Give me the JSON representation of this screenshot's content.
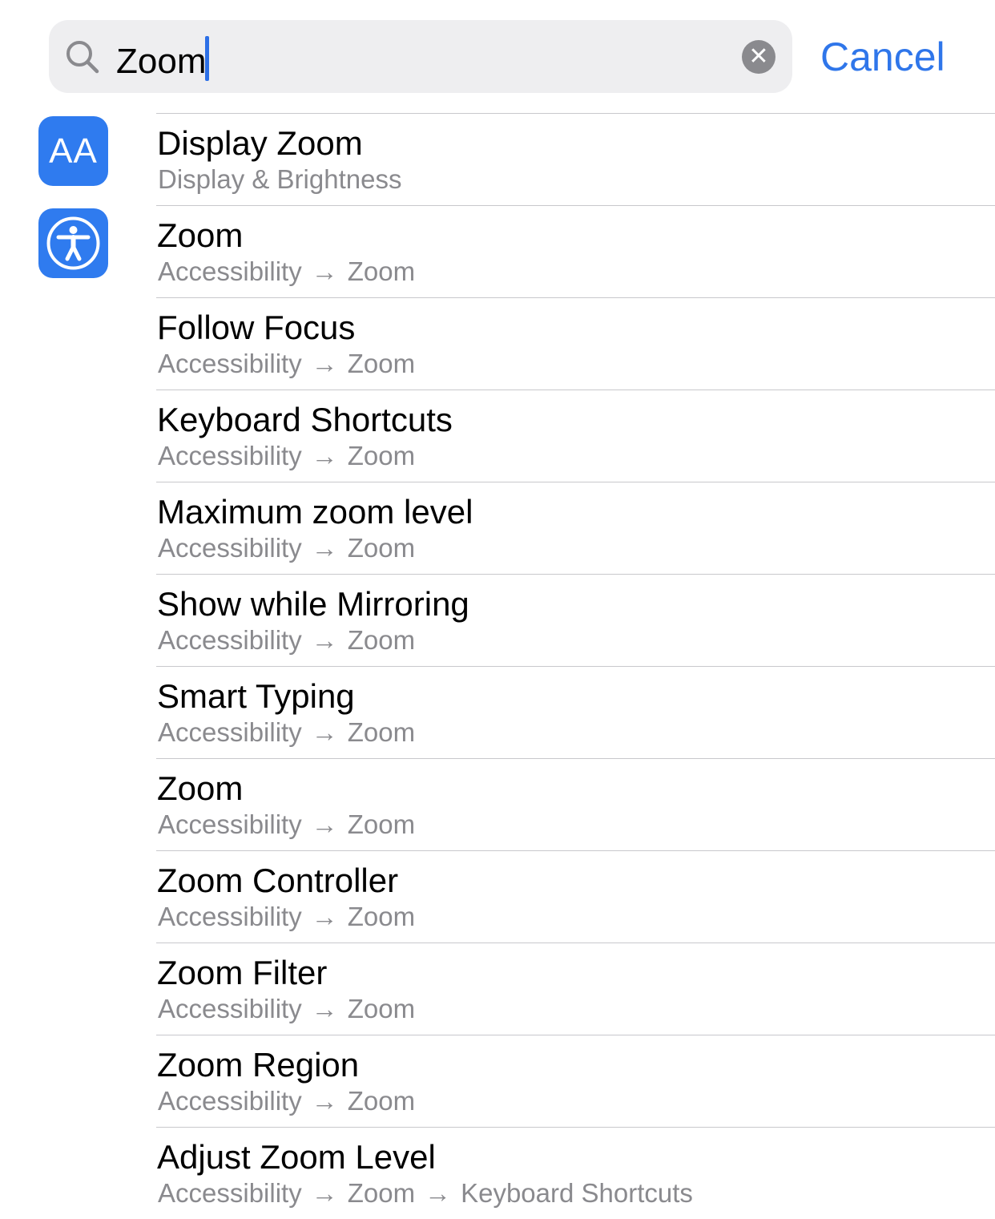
{
  "search": {
    "query": "Zoom",
    "cancel_label": "Cancel",
    "clear_glyph": "✕"
  },
  "icons": {
    "text_size_icon": "AA",
    "accessibility_icon": "accessibility-person"
  },
  "colors": {
    "accent": "#2f76ea",
    "icon_blue": "#2f7bef"
  },
  "results": [
    {
      "title": "Display Zoom",
      "path": [
        "Display & Brightness"
      ],
      "icon": "text-size"
    },
    {
      "title": "Zoom",
      "path": [
        "Accessibility",
        "Zoom"
      ],
      "icon": "accessibility"
    },
    {
      "title": "Follow Focus",
      "path": [
        "Accessibility",
        "Zoom"
      ]
    },
    {
      "title": "Keyboard Shortcuts",
      "path": [
        "Accessibility",
        "Zoom"
      ]
    },
    {
      "title": "Maximum zoom level",
      "path": [
        "Accessibility",
        "Zoom"
      ]
    },
    {
      "title": "Show while Mirroring",
      "path": [
        "Accessibility",
        "Zoom"
      ]
    },
    {
      "title": "Smart Typing",
      "path": [
        "Accessibility",
        "Zoom"
      ]
    },
    {
      "title": "Zoom",
      "path": [
        "Accessibility",
        "Zoom"
      ]
    },
    {
      "title": "Zoom Controller",
      "path": [
        "Accessibility",
        "Zoom"
      ]
    },
    {
      "title": "Zoom Filter",
      "path": [
        "Accessibility",
        "Zoom"
      ]
    },
    {
      "title": "Zoom Region",
      "path": [
        "Accessibility",
        "Zoom"
      ]
    },
    {
      "title": "Adjust Zoom Level",
      "path": [
        "Accessibility",
        "Zoom",
        "Keyboard Shortcuts"
      ]
    }
  ],
  "path_separator": "→"
}
